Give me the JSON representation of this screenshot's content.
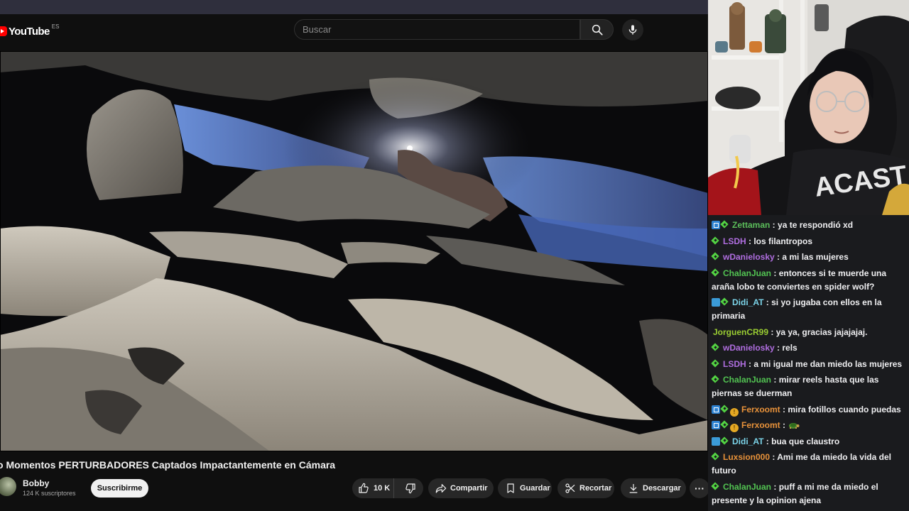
{
  "youtube": {
    "logo_text": "YouTube",
    "country_code": "ES",
    "search_placeholder": "Buscar",
    "search_icon": "search-icon",
    "mic_icon": "microphone-icon",
    "video_title": "o Momentos PERTURBADORES Captados Impactantemente en Cámara",
    "channel_name": "Bobby",
    "channel_subscribers": "124 K suscriptores",
    "subscribe_label": "Suscribirme",
    "actions": {
      "like_count": "10 K",
      "share_label": "Compartir",
      "save_label": "Guardar",
      "clip_label": "Recortar",
      "download_label": "Descargar",
      "more_glyph": "···"
    }
  },
  "chat": {
    "messages": [
      {
        "badges": [
          "prime",
          "diamond"
        ],
        "user": "Zettaman",
        "color": "#5bbd5a",
        "text": "ya te respondió xd"
      },
      {
        "badges": [
          "diamond"
        ],
        "user": "LSDH",
        "color": "#b06ee0",
        "text": "los filantropos"
      },
      {
        "badges": [
          "diamond"
        ],
        "user": "wDanielosky",
        "color": "#b06ee0",
        "text": "a mi las mujeres"
      },
      {
        "badges": [
          "diamond"
        ],
        "user": "ChalanJuan",
        "color": "#52c452",
        "text": "entonces si te muerde una araña lobo te conviertes en spider wolf?"
      },
      {
        "badges": [
          "cube",
          "diamond"
        ],
        "user": "Didi_AT",
        "color": "#7bd3e8",
        "text": "si yo jugaba con ellos en la primaria"
      },
      {
        "badges": [],
        "user": "JorguenCR99",
        "color": "#9acd32",
        "text": "ya ya, gracias jajajajaj."
      },
      {
        "badges": [
          "diamond"
        ],
        "user": "wDanielosky",
        "color": "#b06ee0",
        "text": "rels"
      },
      {
        "badges": [
          "diamond"
        ],
        "user": "LSDH",
        "color": "#b06ee0",
        "text": "a mi igual me dan miedo las mujeres"
      },
      {
        "badges": [
          "diamond"
        ],
        "user": "ChalanJuan",
        "color": "#52c452",
        "text": "mirar reels hasta que las piernas se duerman"
      },
      {
        "badges": [
          "prime",
          "diamond",
          "coin"
        ],
        "user": "Ferxoomt",
        "color": "#e8923a",
        "text": "mira fotillos cuando puedas"
      },
      {
        "badges": [
          "prime",
          "diamond",
          "coin"
        ],
        "user": "Ferxoomt",
        "color": "#e8923a",
        "text": "",
        "emote": "turtle-emote"
      },
      {
        "badges": [
          "cube",
          "diamond"
        ],
        "user": "Didi_AT",
        "color": "#7bd3e8",
        "text": "bua que claustro"
      },
      {
        "badges": [
          "diamond"
        ],
        "user": "Luxsion000",
        "color": "#e8923a",
        "text": "Ami me da miedo la vida del futuro"
      },
      {
        "badges": [
          "diamond"
        ],
        "user": "ChalanJuan",
        "color": "#52c452",
        "text": "puff a mi me da miedo el presente y la opinion ajena"
      }
    ]
  }
}
